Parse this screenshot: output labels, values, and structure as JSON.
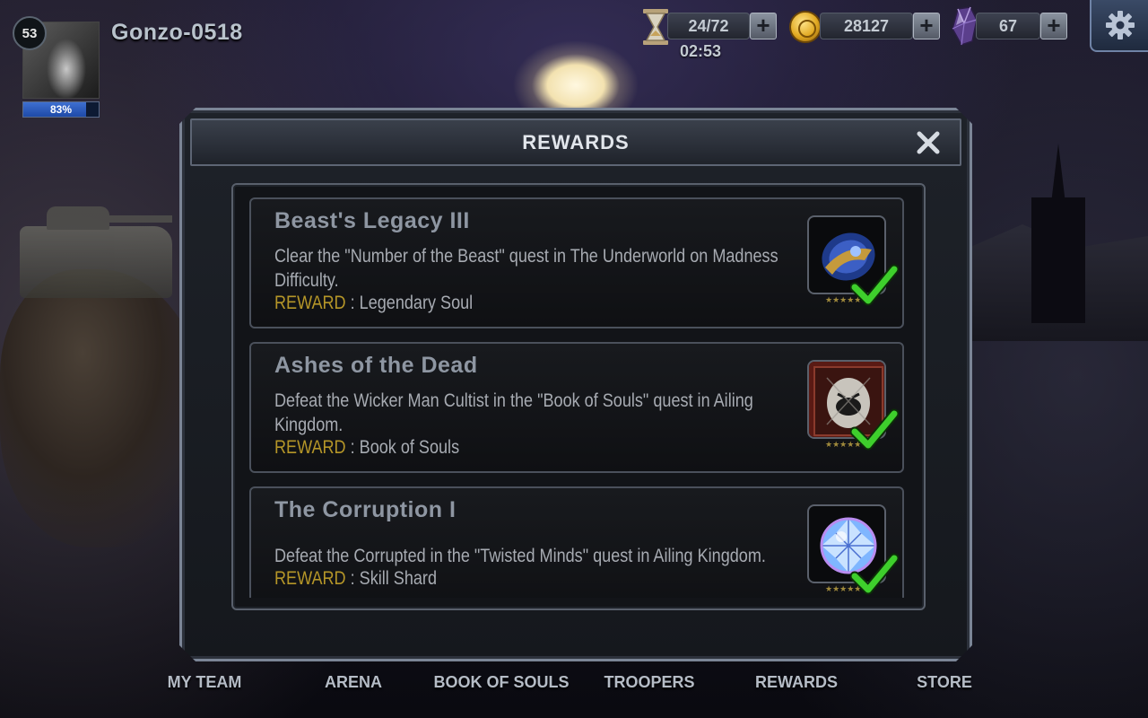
{
  "player": {
    "level": "53",
    "name": "Gonzo-0518",
    "xp_label": "83%",
    "xp_fraction": 0.83
  },
  "resources": {
    "energy": "24/72",
    "energy_timer": "02:53",
    "gold": "28127",
    "gems": "67"
  },
  "modal": {
    "title": "REWARDS"
  },
  "quests": [
    {
      "title": "Beast's Legacy III",
      "description": "Clear the \"Number of the Beast\" quest in The Underworld on Madness Difficulty.",
      "reward_key": "REWARD",
      "reward_sep": " : ",
      "reward_value": "Legendary Soul",
      "stars": "★★★★★",
      "icon": "legendary-soul-icon",
      "completed": true
    },
    {
      "title": "Ashes of the Dead",
      "description": "Defeat the Wicker Man Cultist in the \"Book of Souls\" quest in Ailing Kingdom.",
      "reward_key": "REWARD",
      "reward_sep": " : ",
      "reward_value": "Book of Souls",
      "stars": "★★★★★",
      "icon": "book-of-souls-icon",
      "completed": true
    },
    {
      "title": "The Corruption I",
      "description": "Defeat the Corrupted in the \"Twisted Minds\" quest in Ailing Kingdom.",
      "reward_key": "REWARD",
      "reward_sep": " : ",
      "reward_value": "Skill Shard",
      "stars": "★★★★★",
      "icon": "skill-shard-icon",
      "completed": true
    }
  ],
  "nav": [
    "MY TEAM",
    "ARENA",
    "BOOK OF SOULS",
    "TROOPERS",
    "REWARDS",
    "STORE"
  ],
  "colors": {
    "reward_key": "#b59628",
    "check": "#3ecf2c",
    "xp_bar": "#2f5fc4"
  }
}
